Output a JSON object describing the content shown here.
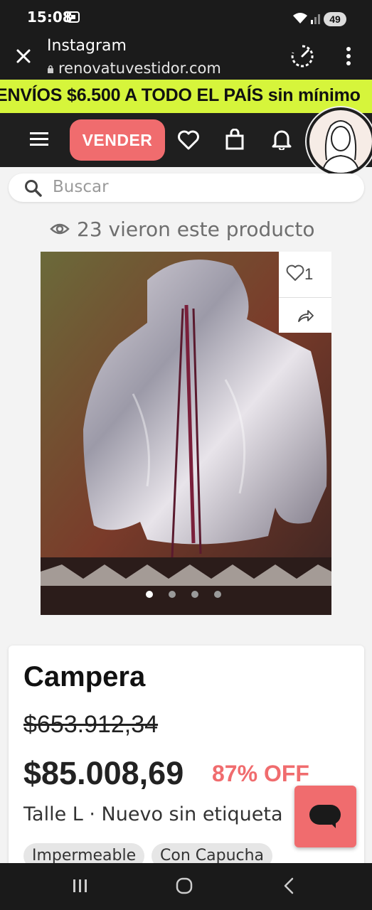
{
  "status_bar": {
    "time": "15:08",
    "battery": "49"
  },
  "browser": {
    "title": "Instagram",
    "url": "renovatuvestidor.com"
  },
  "promo": {
    "text": "ENVÍOS $6.500 A TODO EL PAÍS sin mínimo"
  },
  "nav": {
    "sell_label": "VENDER"
  },
  "search": {
    "placeholder": "Buscar"
  },
  "product": {
    "views_text": "23 vieron este producto",
    "likes": "1",
    "image_count": 4,
    "active_image": 1,
    "name": "Campera",
    "original_price": "$653.912,34",
    "price": "$85.008,69",
    "discount": "87% OFF",
    "meta": "Talle L · Nuevo sin etiqueta",
    "tags": [
      "Impermeable",
      "Con Capucha"
    ]
  },
  "colors": {
    "brand_coral": "#f06c6e",
    "promo_lime": "#d6f53b",
    "dark": "#1f1f1f"
  }
}
